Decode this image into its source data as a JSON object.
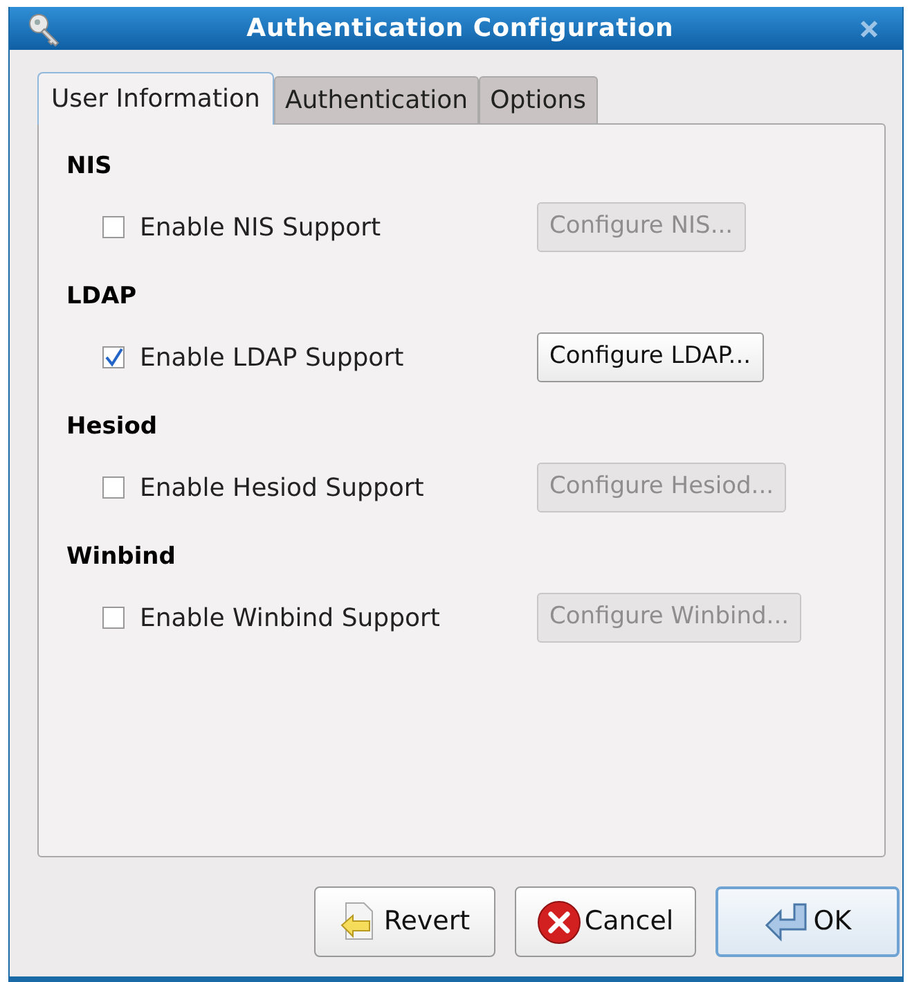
{
  "window": {
    "title": "Authentication Configuration"
  },
  "tabs": [
    {
      "label": "User Information",
      "selected": true
    },
    {
      "label": "Authentication",
      "selected": false
    },
    {
      "label": "Options",
      "selected": false
    }
  ],
  "sections": [
    {
      "heading": "NIS",
      "checkbox": {
        "label": "Enable NIS Support",
        "checked": false
      },
      "button": {
        "label": "Configure NIS...",
        "disabled": true
      }
    },
    {
      "heading": "LDAP",
      "checkbox": {
        "label": "Enable LDAP Support",
        "checked": true
      },
      "button": {
        "label": "Configure LDAP...",
        "disabled": false
      }
    },
    {
      "heading": "Hesiod",
      "checkbox": {
        "label": "Enable Hesiod Support",
        "checked": false
      },
      "button": {
        "label": "Configure Hesiod...",
        "disabled": true
      }
    },
    {
      "heading": "Winbind",
      "checkbox": {
        "label": "Enable Winbind Support",
        "checked": false
      },
      "button": {
        "label": "Configure Winbind...",
        "disabled": true
      }
    }
  ],
  "buttons": [
    {
      "kind": "revert",
      "label": "Revert",
      "focused": false
    },
    {
      "kind": "cancel",
      "label": "Cancel",
      "focused": false
    },
    {
      "kind": "ok",
      "label": "OK",
      "focused": true
    }
  ]
}
